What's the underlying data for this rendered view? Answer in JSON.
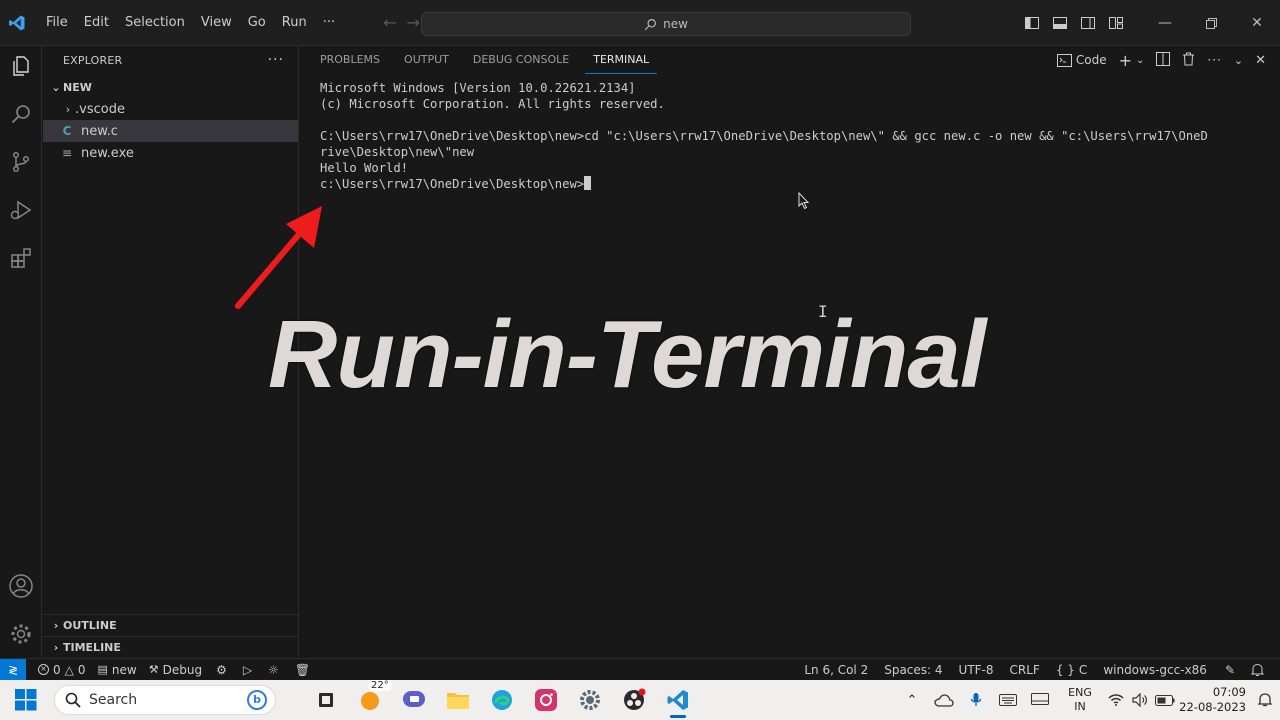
{
  "titlebar": {
    "menu": [
      "File",
      "Edit",
      "Selection",
      "View",
      "Go",
      "Run",
      "···"
    ],
    "search_text": "new",
    "icons": [
      "vscode-logo-icon",
      "back-arrow-icon",
      "forward-arrow-icon",
      "toggle-primary-sidebar-icon",
      "toggle-panel-icon",
      "toggle-secondary-sidebar-icon",
      "customize-layout-icon",
      "minimize-icon",
      "restore-icon",
      "close-icon"
    ]
  },
  "activitybar": {
    "icons": [
      "explorer-icon",
      "search-icon",
      "source-control-icon",
      "run-debug-icon",
      "extensions-icon",
      "accounts-icon",
      "manage-gear-icon"
    ]
  },
  "sidebar": {
    "title": "EXPLORER",
    "more": "···",
    "folder": "NEW",
    "items": [
      {
        "label": ".vscode",
        "kind": "folder"
      },
      {
        "label": "new.c",
        "kind": "c-file",
        "glyph": "C"
      },
      {
        "label": "new.exe",
        "kind": "exe-file",
        "glyph": "≡"
      }
    ],
    "outline": "OUTLINE",
    "timeline": "TIMELINE"
  },
  "panel": {
    "tabs": [
      "PROBLEMS",
      "OUTPUT",
      "DEBUG CONSOLE",
      "TERMINAL"
    ],
    "active_tab": "TERMINAL",
    "terminal_label": "Code",
    "terminal_lines": [
      "Microsoft Windows [Version 10.0.22621.2134]",
      "(c) Microsoft Corporation. All rights reserved.",
      "",
      "C:\\Users\\rrw17\\OneDrive\\Desktop\\new>cd \"c:\\Users\\rrw17\\OneDrive\\Desktop\\new\\\" && gcc new.c -o new && \"c:\\Users\\rrw17\\OneD",
      "rive\\Desktop\\new\\\"new",
      "Hello World!"
    ],
    "prompt": "c:\\Users\\rrw17\\OneDrive\\Desktop\\new>"
  },
  "overlay": {
    "title": "Run-in-Terminal",
    "arrow_color": "#ee1c1c"
  },
  "statusbar": {
    "errors": "0",
    "warnings": "0",
    "folder": "new",
    "debug": "Debug",
    "position": "Ln 6, Col 2",
    "spaces": "Spaces: 4",
    "encoding": "UTF-8",
    "eol": "CRLF",
    "language": "C",
    "config": "windows-gcc-x86",
    "accent": "#0078d4"
  },
  "taskbar": {
    "search": "Search",
    "weather": "22°",
    "apps": [
      "file-manager-icon",
      "weather-icon",
      "chat-icon",
      "folder-icon",
      "edge-icon",
      "instagram-icon",
      "settings-icon",
      "obs-icon",
      "vscode-taskbar-icon"
    ],
    "lang_1": "ENG",
    "lang_2": "IN",
    "time": "07:09",
    "date": "22-08-2023"
  }
}
